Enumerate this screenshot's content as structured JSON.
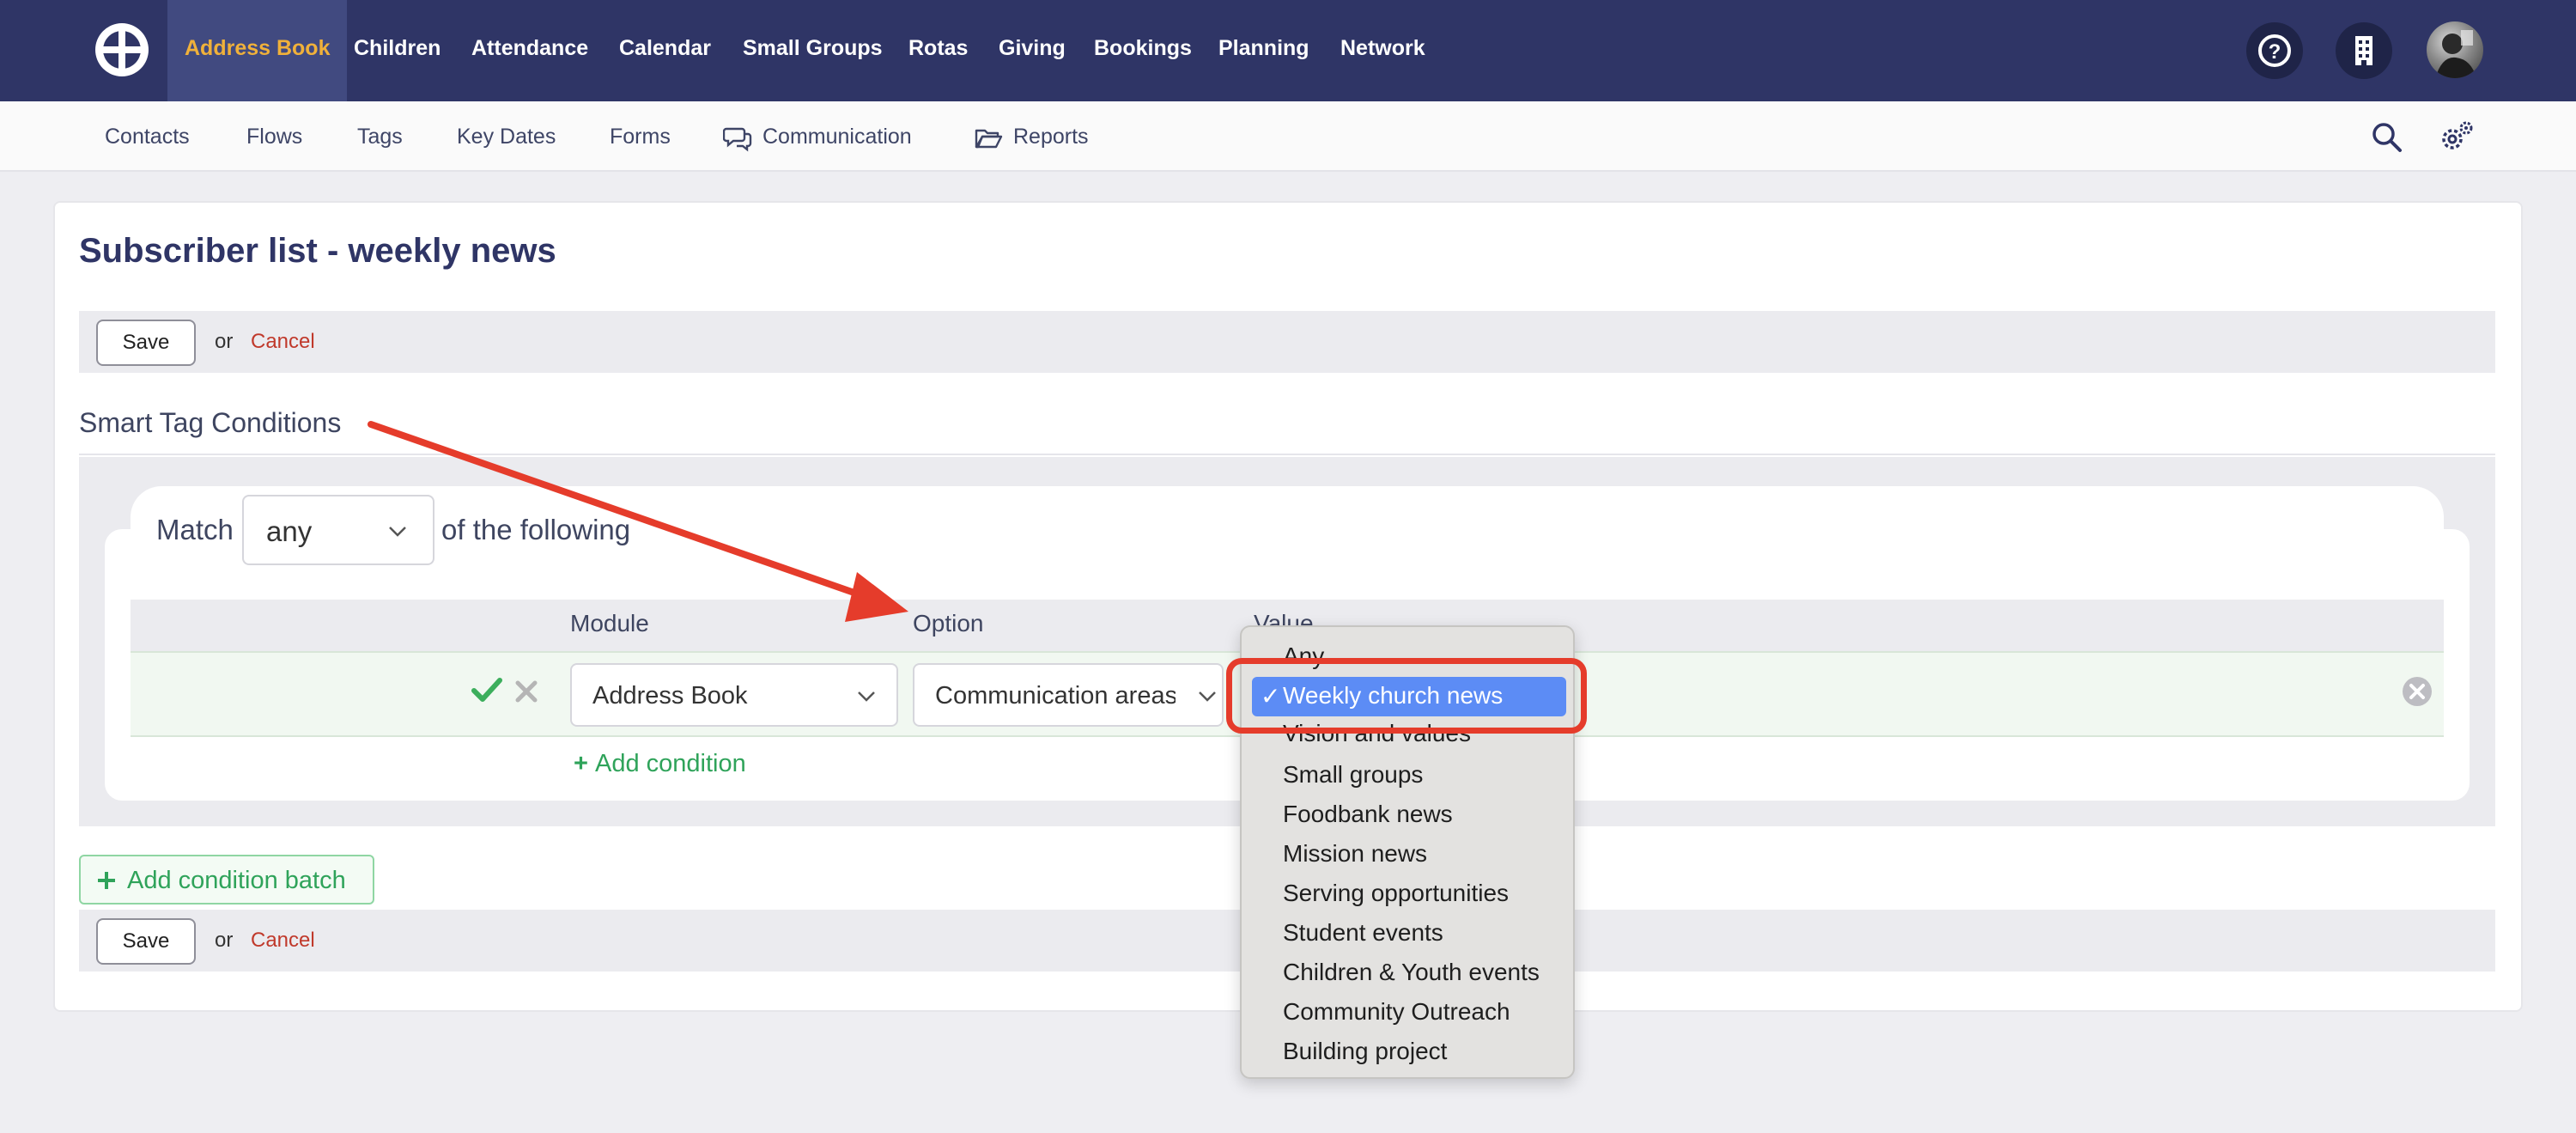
{
  "colors": {
    "nav_bg": "#2f3566",
    "nav_active_text": "#f0b13a",
    "cancel": "#c0392b",
    "add_green": "#2fa35a",
    "dropdown_selected": "#5c8cf5",
    "annotation_red": "#e53c2b"
  },
  "topnav": {
    "items": [
      "Address Book",
      "Children",
      "Attendance",
      "Calendar",
      "Small Groups",
      "Rotas",
      "Giving",
      "Bookings",
      "Planning",
      "Network"
    ],
    "active": "Address Book",
    "icons": [
      "help-icon",
      "building-icon",
      "user-avatar"
    ]
  },
  "subnav": {
    "items": [
      "Contacts",
      "Flows",
      "Tags",
      "Key Dates",
      "Forms",
      "Communication",
      "Reports"
    ],
    "icons": [
      "search-icon",
      "settings-icon"
    ]
  },
  "page": {
    "title": "Subscriber list - weekly news",
    "save_label": "Save",
    "or_label": "or",
    "cancel_label": "Cancel"
  },
  "conditions": {
    "section_title": "Smart Tag Conditions",
    "match_prefix": "Match",
    "match_value": "any",
    "match_suffix": "of the following",
    "columns": [
      "Module",
      "Option",
      "Value"
    ],
    "row": {
      "module": "Address Book",
      "option": "Communication areas"
    },
    "add_condition": "Add condition",
    "add_batch": "Add condition batch"
  },
  "dropdown": {
    "selected": "Weekly church news",
    "options": [
      "Any",
      "Weekly church news",
      "Vision and values",
      "Small groups",
      "Foodbank news",
      "Mission news",
      "Serving opportunities",
      "Student events",
      "Children & Youth events",
      "Community Outreach",
      "Building project"
    ]
  }
}
